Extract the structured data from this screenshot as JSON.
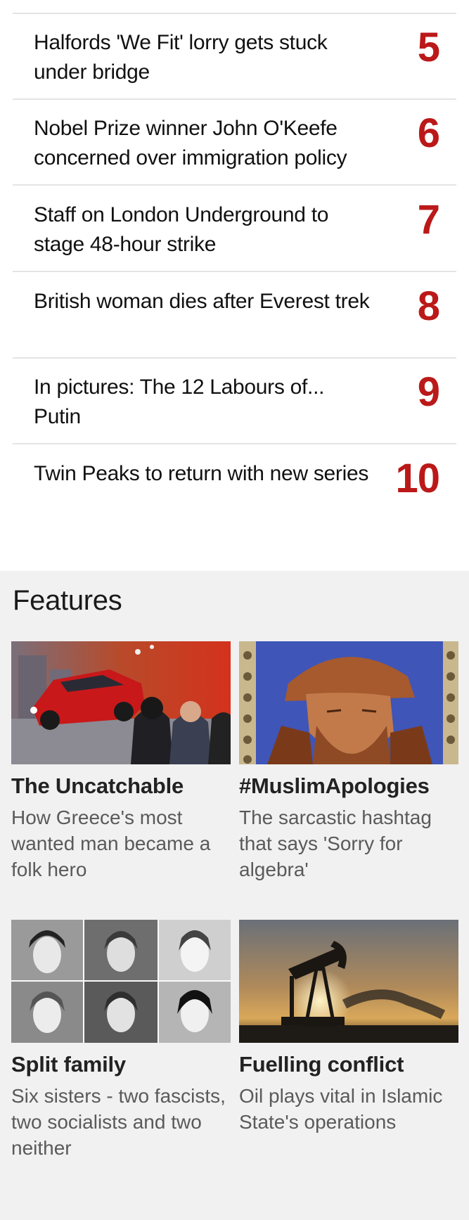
{
  "most_read": {
    "items": [
      {
        "title": "Halfords 'We Fit' lorry gets stuck under bridge",
        "rank": "5"
      },
      {
        "title": "Nobel Prize winner John O'Keefe concerned over immigration policy",
        "rank": "6"
      },
      {
        "title": "Staff on London Underground to stage 48-hour strike",
        "rank": "7"
      },
      {
        "title": "British woman dies after Everest trek",
        "rank": "8"
      },
      {
        "title": "In pictures: The 12 Labours of... Putin",
        "rank": "9"
      },
      {
        "title": "Twin Peaks to return with new series",
        "rank": "10"
      }
    ]
  },
  "features": {
    "heading": "Features",
    "cards": [
      {
        "title": "The Uncatchable",
        "summary": "How Greece's most wanted man became a folk hero"
      },
      {
        "title": "#MuslimApologies",
        "summary": "The sarcastic hashtag that says 'Sorry for algebra'"
      },
      {
        "title": "Split family",
        "summary": "Six sisters - two fascists, two socialists and two neither"
      },
      {
        "title": "Fuelling conflict",
        "summary": "Oil plays vital in Islamic State's operations"
      }
    ]
  },
  "colors": {
    "rank": "#bb1919",
    "features_bg": "#f1f1f1",
    "divider": "#e4e4e4"
  }
}
